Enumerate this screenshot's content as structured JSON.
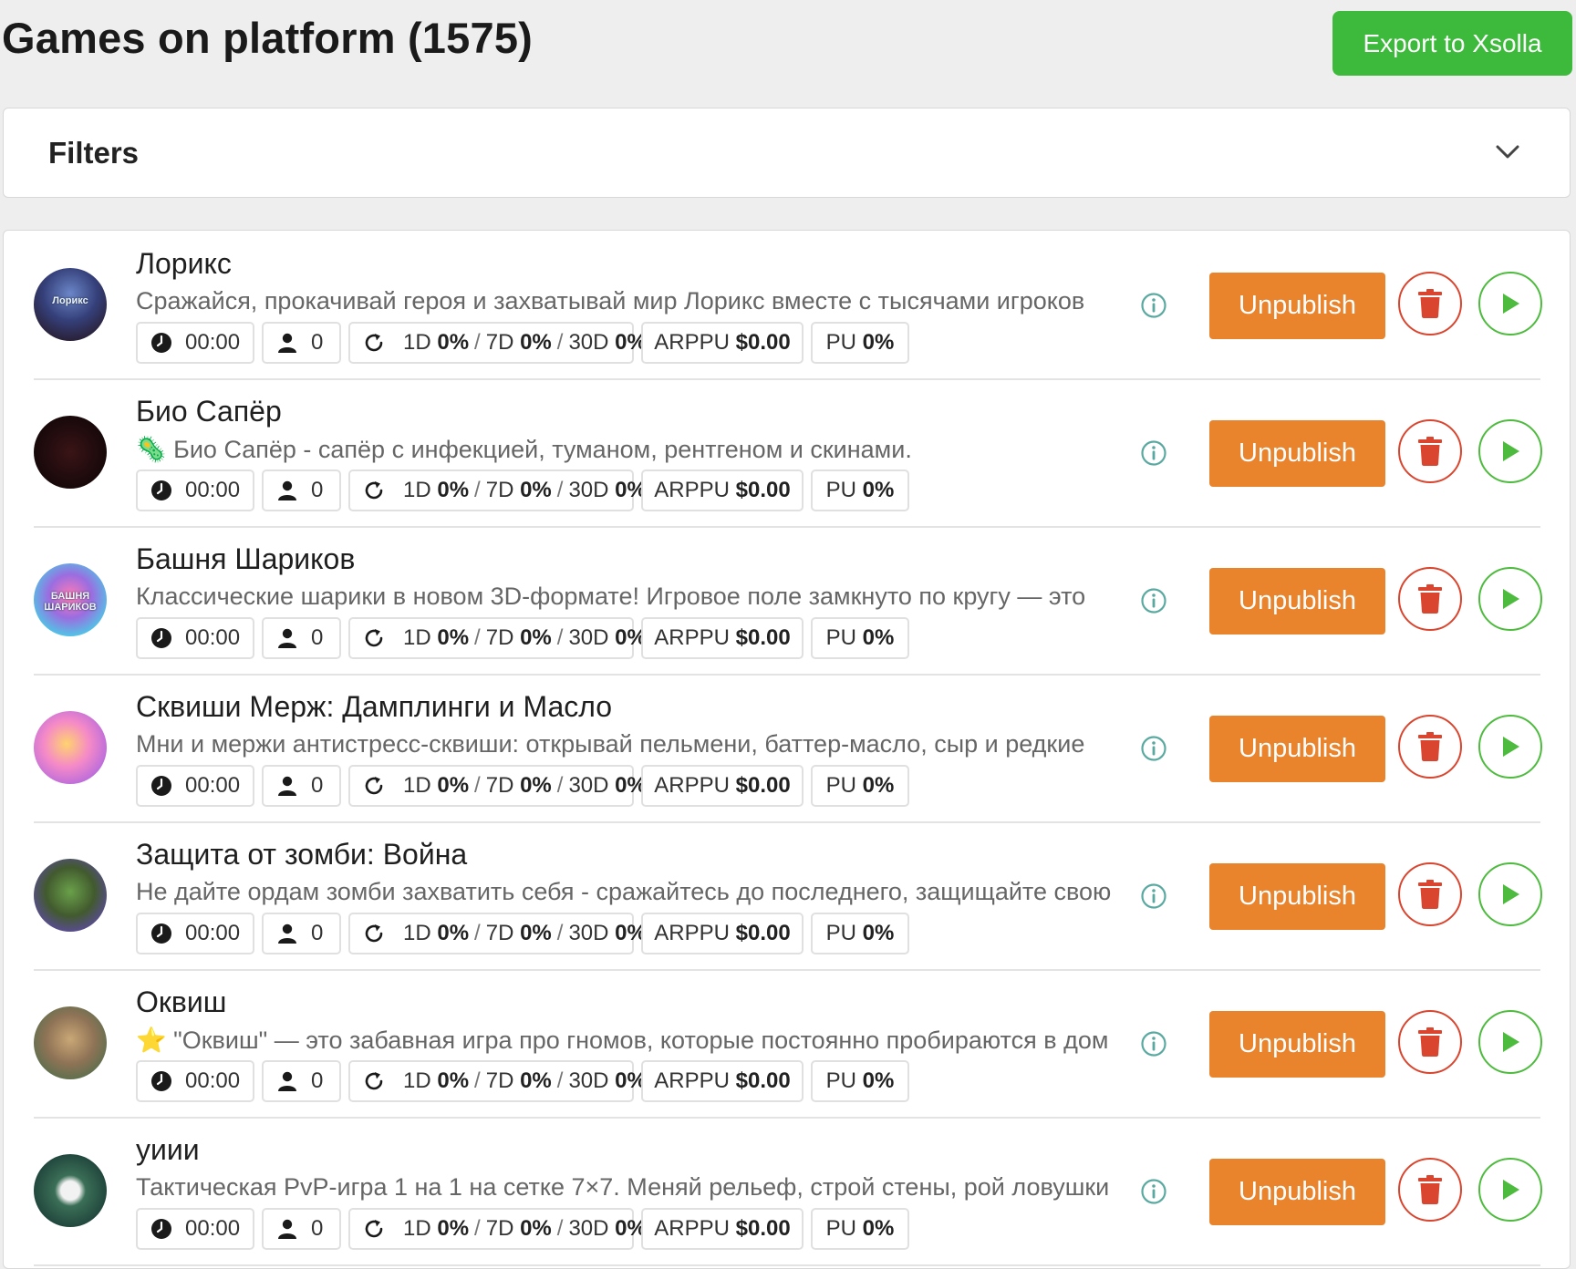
{
  "header": {
    "title": "Games on platform (1575)",
    "export_label": "Export to Xsolla"
  },
  "filters": {
    "label": "Filters",
    "chevron_icon": "chevron-down-icon"
  },
  "actions": {
    "unpublish_label": "Unpublish",
    "delete_icon": "trash-icon",
    "play_icon": "play-icon",
    "info_icon": "info-icon"
  },
  "colors": {
    "export_green": "#3dba3b",
    "unpublish_orange": "#e9832c",
    "delete_red": "#d9452e",
    "play_green": "#4dbb3d",
    "info_teal": "#5aa9a0"
  },
  "stat_labels": {
    "d1": "1D",
    "d7": "7D",
    "d30": "30D",
    "arppu": "ARPPU",
    "pu": "PU"
  },
  "games": [
    {
      "title": "Лорикс",
      "description": "Сражайся, прокачивай героя и захватывай мир Лорикс вместе с тысячами игроков",
      "time": "00:00",
      "players": "0",
      "d1": "0%",
      "d7": "0%",
      "d30": "0%",
      "arppu": "$0.00",
      "pu": "0%",
      "avatar_text": "Лорикс"
    },
    {
      "title": "Био Сапёр",
      "description": "🦠 Био Сапёр - сапёр с инфекцией, туманом, рентгеном и скинами.",
      "time": "00:00",
      "players": "0",
      "d1": "0%",
      "d7": "0%",
      "d30": "0%",
      "arppu": "$0.00",
      "pu": "0%",
      "avatar_text": ""
    },
    {
      "title": "Башня Шариков",
      "description": "Классические шарики в новом 3D-формате! Игровое поле замкнуто по кругу — это",
      "time": "00:00",
      "players": "0",
      "d1": "0%",
      "d7": "0%",
      "d30": "0%",
      "arppu": "$0.00",
      "pu": "0%",
      "avatar_text": "БАШНЯ ШАРИКОВ"
    },
    {
      "title": "Сквиши Мерж: Дамплинги и Масло",
      "description": "Мни и мержи антистресс-сквиши: открывай пельмени, баттер-масло, сыр и редкие",
      "time": "00:00",
      "players": "0",
      "d1": "0%",
      "d7": "0%",
      "d30": "0%",
      "arppu": "$0.00",
      "pu": "0%",
      "avatar_text": ""
    },
    {
      "title": "Защита от зомби: Война",
      "description": "Не дайте ордам зомби захватить себя - сражайтесь до последнего, защищайте свою",
      "time": "00:00",
      "players": "0",
      "d1": "0%",
      "d7": "0%",
      "d30": "0%",
      "arppu": "$0.00",
      "pu": "0%",
      "avatar_text": ""
    },
    {
      "title": "Оквиш",
      "description": "⭐ \"Оквиш\" — это забавная игра про гномов, которые постоянно пробираются в дом",
      "time": "00:00",
      "players": "0",
      "d1": "0%",
      "d7": "0%",
      "d30": "0%",
      "arppu": "$0.00",
      "pu": "0%",
      "avatar_text": ""
    },
    {
      "title": "уиии",
      "description": "Тактическая PvP-игра 1 на 1 на сетке 7×7. Меняй рельеф, строй стены, рой ловушки",
      "time": "00:00",
      "players": "0",
      "d1": "0%",
      "d7": "0%",
      "d30": "0%",
      "arppu": "$0.00",
      "pu": "0%",
      "avatar_text": ""
    }
  ]
}
